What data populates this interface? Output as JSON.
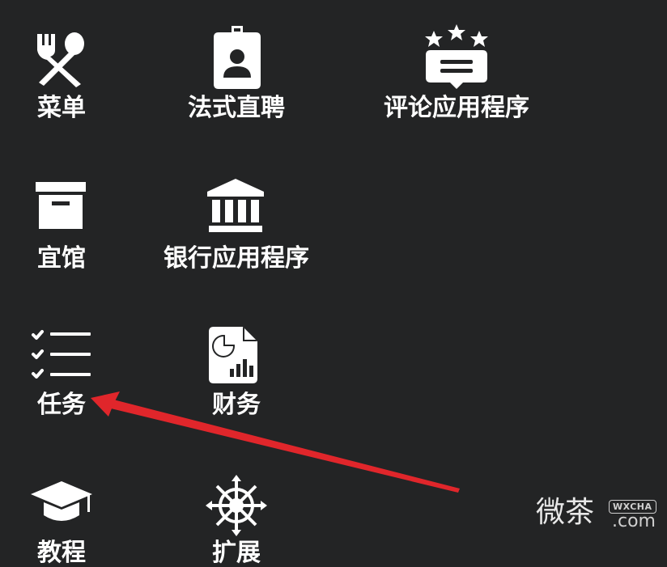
{
  "apps": [
    {
      "label": "菜单",
      "icon": "fork-spoon-icon"
    },
    {
      "label": "法式直聘",
      "icon": "id-badge-icon"
    },
    {
      "label": "评论应用程序",
      "icon": "review-stars-icon"
    },
    {
      "label": "宜馆",
      "icon": "archive-box-icon"
    },
    {
      "label": "银行应用程序",
      "icon": "bank-icon"
    },
    {
      "label": "任务",
      "icon": "checklist-icon"
    },
    {
      "label": "财务",
      "icon": "finance-report-icon"
    },
    {
      "label": "教程",
      "icon": "graduation-cap-icon"
    },
    {
      "label": "扩展",
      "icon": "ship-wheel-icon"
    }
  ],
  "watermark": {
    "text": "微茶",
    "badge": "WXCHA",
    "url": ".com"
  },
  "colors": {
    "background": "#232425",
    "text": "#ffffff",
    "arrow": "#e0262b"
  }
}
